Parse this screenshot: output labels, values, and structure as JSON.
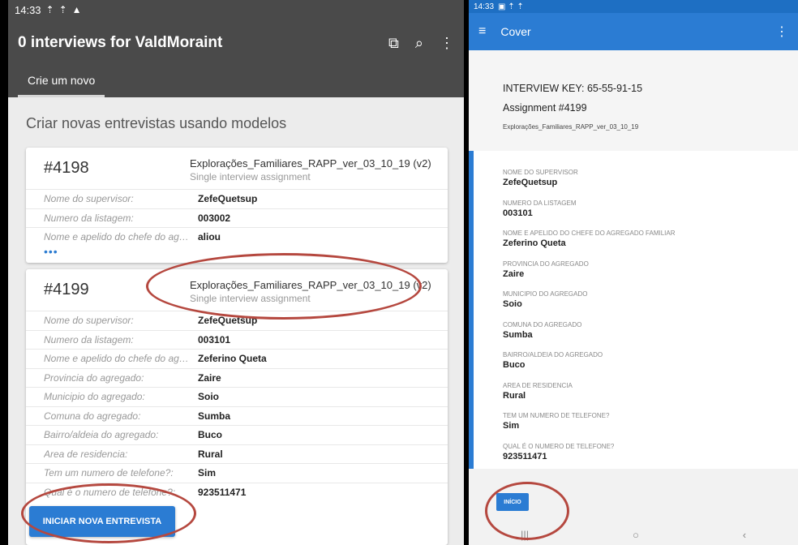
{
  "left_phone": {
    "status_time": "14:33",
    "app_title": "0 interviews for ValdMoraint",
    "tab_create": "Crie um novo",
    "section_title": "Criar novas entrevistas usando modelos",
    "cards": [
      {
        "number": "#4198",
        "template": "Explorações_Familiares_RAPP_ver_03_10_19 (v2)",
        "subtitle": "Single interview assignment",
        "rows": [
          {
            "label": "Nome do supervisor:",
            "value": "ZefeQuetsup"
          },
          {
            "label": "Numero da listagem:",
            "value": "003002"
          },
          {
            "label": "Nome e apelido do chefe do agrega...",
            "value": "aliou"
          }
        ],
        "more": "•••"
      },
      {
        "number": "#4199",
        "template": "Explorações_Familiares_RAPP_ver_03_10_19 (v2)",
        "subtitle": "Single interview assignment",
        "rows": [
          {
            "label": "Nome do supervisor:",
            "value": "ZefeQuetsup"
          },
          {
            "label": "Numero da listagem:",
            "value": "003101"
          },
          {
            "label": "Nome e apelido do chefe do agreg...",
            "value": "Zeferino Queta"
          },
          {
            "label": "Provincia do agregado:",
            "value": "Zaire"
          },
          {
            "label": "Municipio do agregado:",
            "value": "Soio"
          },
          {
            "label": "Comuna do agregado:",
            "value": "Sumba"
          },
          {
            "label": "Bairro/aldeia do agregado:",
            "value": "Buco"
          },
          {
            "label": "Area de residencia:",
            "value": "Rural"
          },
          {
            "label": "Tem um numero de telefone?:",
            "value": "Sim"
          },
          {
            "label": "Qual é o numero de telefone?:",
            "value": "923511471"
          }
        ]
      }
    ],
    "start_button": "INICIAR NOVA ENTREVISTA"
  },
  "right_tablet": {
    "status_time": "14:33",
    "app_title": "Cover",
    "interview_key": "INTERVIEW KEY: 65-55-91-15",
    "assignment": "Assignment #4199",
    "template": "Explorações_Familiares_RAPP_ver_03_10_19",
    "fields": [
      {
        "label": "NOME DO SUPERVISOR",
        "value": "ZefeQuetsup"
      },
      {
        "label": "NUMERO DA LISTAGEM",
        "value": "003101"
      },
      {
        "label": "NOME E APELIDO DO CHEFE DO AGREGADO FAMILIAR",
        "value": "Zeferino Queta"
      },
      {
        "label": "PROVINCIA DO AGREGADO",
        "value": "Zaire"
      },
      {
        "label": "MUNICIPIO DO AGREGADO",
        "value": "Soio"
      },
      {
        "label": "COMUNA DO AGREGADO",
        "value": "Sumba"
      },
      {
        "label": "BAIRRO/ALDEIA DO AGREGADO",
        "value": "Buco"
      },
      {
        "label": "AREA DE RESIDENCIA",
        "value": "Rural"
      },
      {
        "label": "TEM UM NUMERO DE TELEFONE?",
        "value": "Sim"
      },
      {
        "label": "QUAL É O NUMERO DE TELEFONE?",
        "value": "923511471"
      }
    ],
    "start_button": "INÍCIO"
  },
  "colors": {
    "accent": "#2b7cd3",
    "annotation": "#b5483f",
    "appbar_dark": "#4a4a4a"
  }
}
